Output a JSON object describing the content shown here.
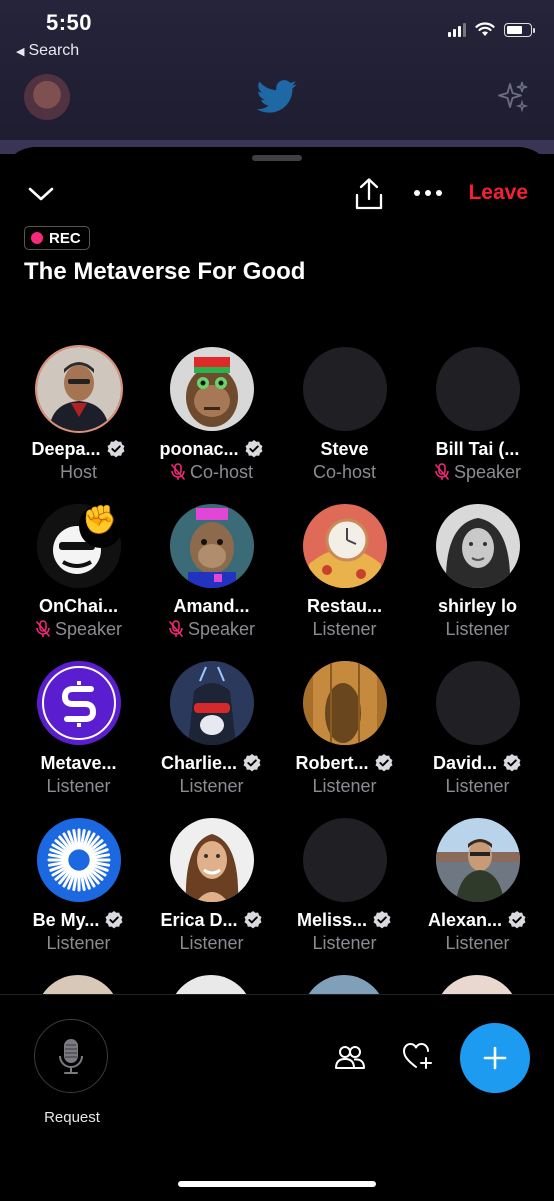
{
  "status_bar": {
    "time": "5:50",
    "back_label": "Search"
  },
  "space": {
    "rec_label": "REC",
    "title": "The Metaverse For Good",
    "leave_label": "Leave"
  },
  "participants": [
    {
      "name": "Deepa...",
      "role": "Host",
      "verified": true,
      "muted": false,
      "avatar": "deepak"
    },
    {
      "name": "poonac...",
      "role": "Co-host",
      "verified": true,
      "muted": true,
      "avatar": "monkey"
    },
    {
      "name": "Steve",
      "role": "Co-host",
      "verified": false,
      "muted": false,
      "avatar": "blank"
    },
    {
      "name": "Bill Tai (...",
      "role": "Speaker",
      "verified": false,
      "muted": true,
      "avatar": "blank"
    },
    {
      "name": "OnChai...",
      "role": "Speaker",
      "verified": false,
      "muted": true,
      "avatar": "onchain"
    },
    {
      "name": "Amand...",
      "role": "Speaker",
      "verified": false,
      "muted": true,
      "avatar": "amanda"
    },
    {
      "name": "Restau...",
      "role": "Listener",
      "verified": false,
      "muted": false,
      "avatar": "clockpizza"
    },
    {
      "name": "shirley lo",
      "role": "Listener",
      "verified": false,
      "muted": false,
      "avatar": "shirley"
    },
    {
      "name": "Metave...",
      "role": "Listener",
      "verified": false,
      "muted": false,
      "avatar": "metave"
    },
    {
      "name": "Charlie...",
      "role": "Listener",
      "verified": true,
      "muted": false,
      "avatar": "charlie"
    },
    {
      "name": "Robert...",
      "role": "Listener",
      "verified": true,
      "muted": false,
      "avatar": "robert"
    },
    {
      "name": "David...",
      "role": "Listener",
      "verified": true,
      "muted": false,
      "avatar": "blank"
    },
    {
      "name": "Be My...",
      "role": "Listener",
      "verified": true,
      "muted": false,
      "avatar": "bemy"
    },
    {
      "name": "Erica D...",
      "role": "Listener",
      "verified": true,
      "muted": false,
      "avatar": "erica"
    },
    {
      "name": "Meliss...",
      "role": "Listener",
      "verified": true,
      "muted": false,
      "avatar": "blank"
    },
    {
      "name": "Alexan...",
      "role": "Listener",
      "verified": true,
      "muted": false,
      "avatar": "alexan"
    }
  ],
  "reaction_emoji": "✊",
  "bottom_bar": {
    "request_label": "Request"
  },
  "colors": {
    "leave": "#f4212e",
    "accent": "#1d9bf0",
    "rec_dot": "#f6287a",
    "mute": "#f6287a"
  },
  "icons": {
    "collapse": "chevron-down-icon",
    "share": "share-icon",
    "more": "more-icon",
    "mic": "microphone-icon",
    "people": "people-icon",
    "react": "heart-plus-icon",
    "compose": "plus-icon"
  }
}
